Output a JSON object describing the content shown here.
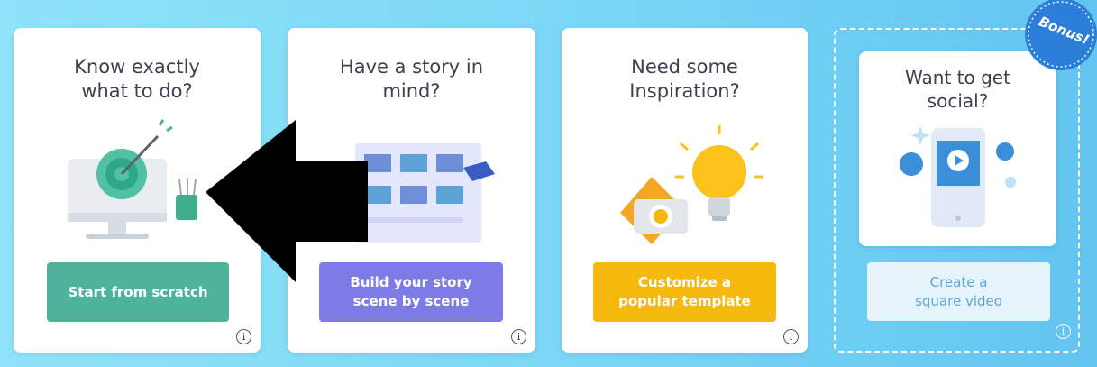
{
  "cards": [
    {
      "title": "Know exactly\nwhat to do?",
      "button": "Start from scratch",
      "button_color": "#4fb39c",
      "info": "i"
    },
    {
      "title": "Have a story in\nmind?",
      "button": "Build your story\nscene by scene",
      "button_color": "#7e7be6",
      "info": "i"
    },
    {
      "title": "Need some\nInspiration?",
      "button": "Customize a\npopular template",
      "button_color": "#f5b80d",
      "info": "i"
    },
    {
      "title": "Want to get\nsocial?",
      "button": "Create a\nsquare video",
      "button_color": "#e5f3fb",
      "info": "i"
    }
  ],
  "bonus_badge": "Bonus!",
  "accent_colors": {
    "background": "#7ad6f5",
    "teal": "#4fb39c",
    "purple": "#7e7be6",
    "orange": "#f5b80d",
    "blue": "#3a8fd8"
  }
}
